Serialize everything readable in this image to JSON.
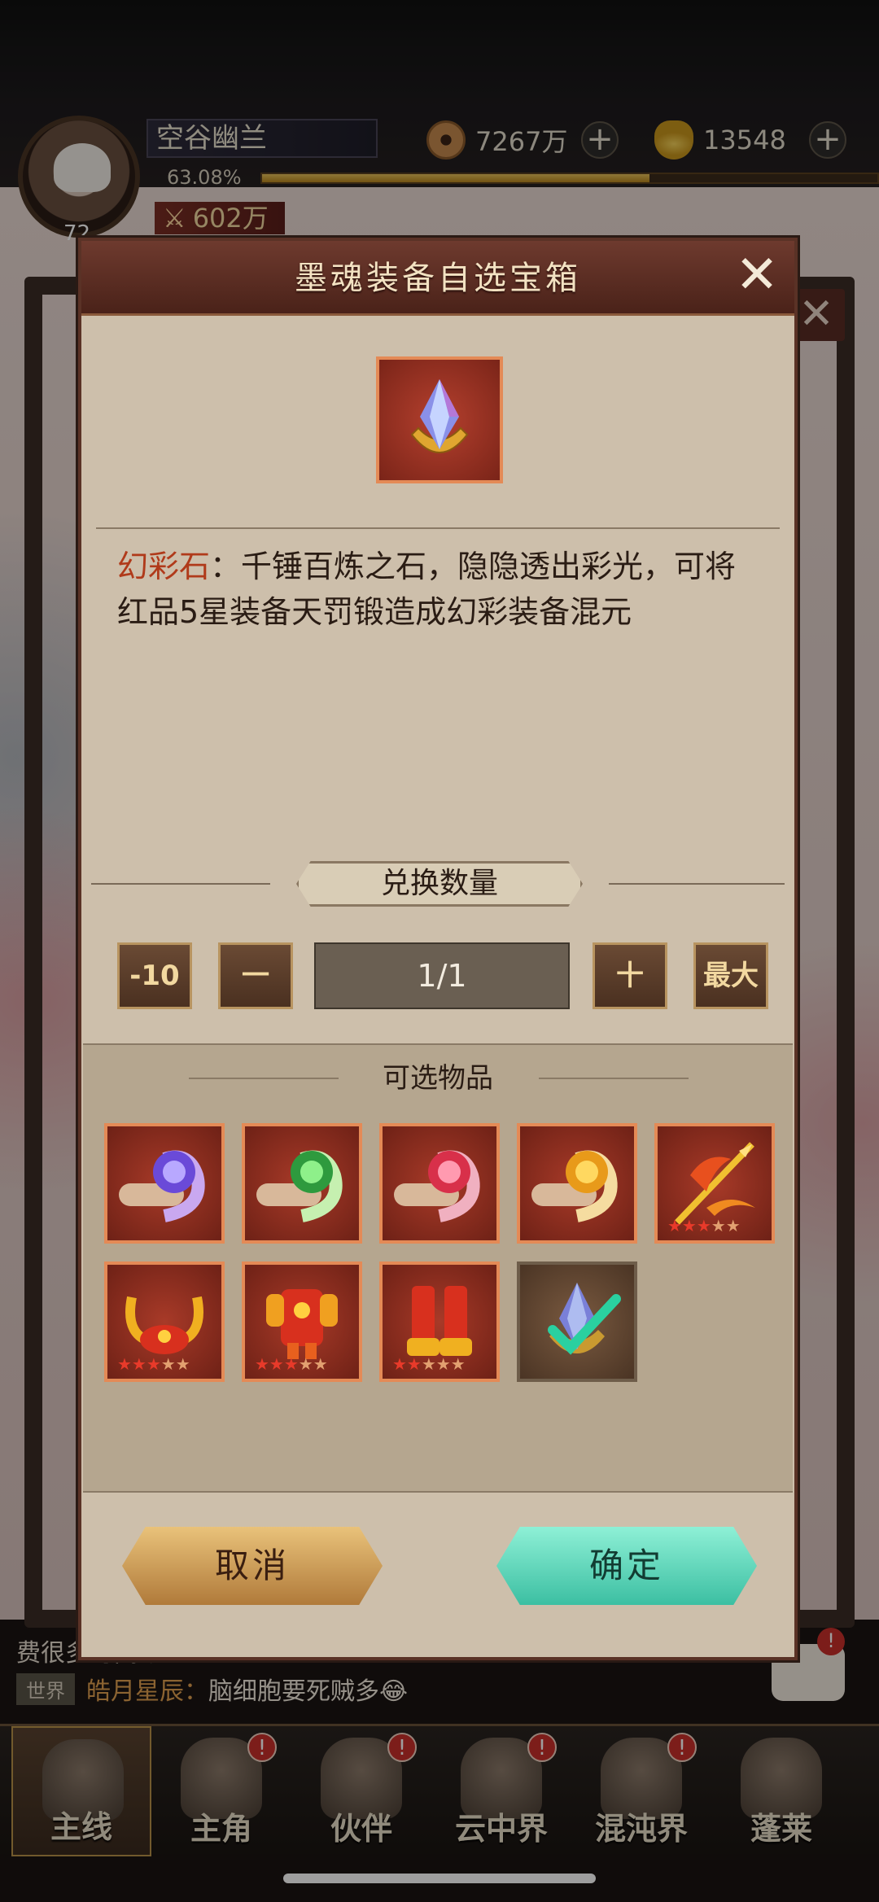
{
  "hud": {
    "player_name": "空谷幽兰",
    "level": "72",
    "exp_percent_text": "63.08%",
    "exp_progress": 0.63,
    "power": "602万",
    "coins": "7267万",
    "ingots": "13548"
  },
  "modal": {
    "title": "墨魂装备自选宝箱",
    "description": {
      "item_name": "幻彩石",
      "separator": "：",
      "text": "千锤百炼之石，隐隐透出彩光，可将红品5星装备天罚锻造成幻彩装备混元"
    },
    "quantity": {
      "title": "兑换数量",
      "minus10_label": "-10",
      "minus_label": "一",
      "value": "1/1",
      "plus_label": "十",
      "max_label": "最大"
    },
    "options": {
      "title": "可选物品",
      "items": [
        {
          "icon": "purple-soul-scroll-icon",
          "stars": 0
        },
        {
          "icon": "green-soul-scroll-icon",
          "stars": 0
        },
        {
          "icon": "red-soul-scroll-icon",
          "stars": 0
        },
        {
          "icon": "gold-soul-scroll-icon",
          "stars": 0
        },
        {
          "icon": "flame-spear-icon",
          "stars": 5,
          "filled": 3
        },
        {
          "icon": "phoenix-helmet-icon",
          "stars": 5,
          "filled": 3
        },
        {
          "icon": "red-armor-icon",
          "stars": 5,
          "filled": 3
        },
        {
          "icon": "red-boots-icon",
          "stars": 5,
          "filled": 2
        },
        {
          "icon": "crystal-selected-icon",
          "stars": 0
        }
      ]
    },
    "cancel_label": "取消",
    "confirm_label": "确定"
  },
  "chat": {
    "line1": "费很多时间😊",
    "channel": "世界",
    "sender": "皓月星辰：",
    "message": "脑细胞要死贼多😂"
  },
  "nav": [
    {
      "label": "主线",
      "badge": ""
    },
    {
      "label": "主角",
      "badge": "!"
    },
    {
      "label": "伙伴",
      "badge": "!"
    },
    {
      "label": "云中界",
      "badge": "!"
    },
    {
      "label": "混沌界",
      "badge": "!"
    },
    {
      "label": "蓬莱",
      "badge": ""
    }
  ],
  "chat_badge": "!",
  "colors": {
    "accent_red": "#b03a1a",
    "confirm": "#3cbfa2",
    "cancel": "#b07a3a"
  }
}
